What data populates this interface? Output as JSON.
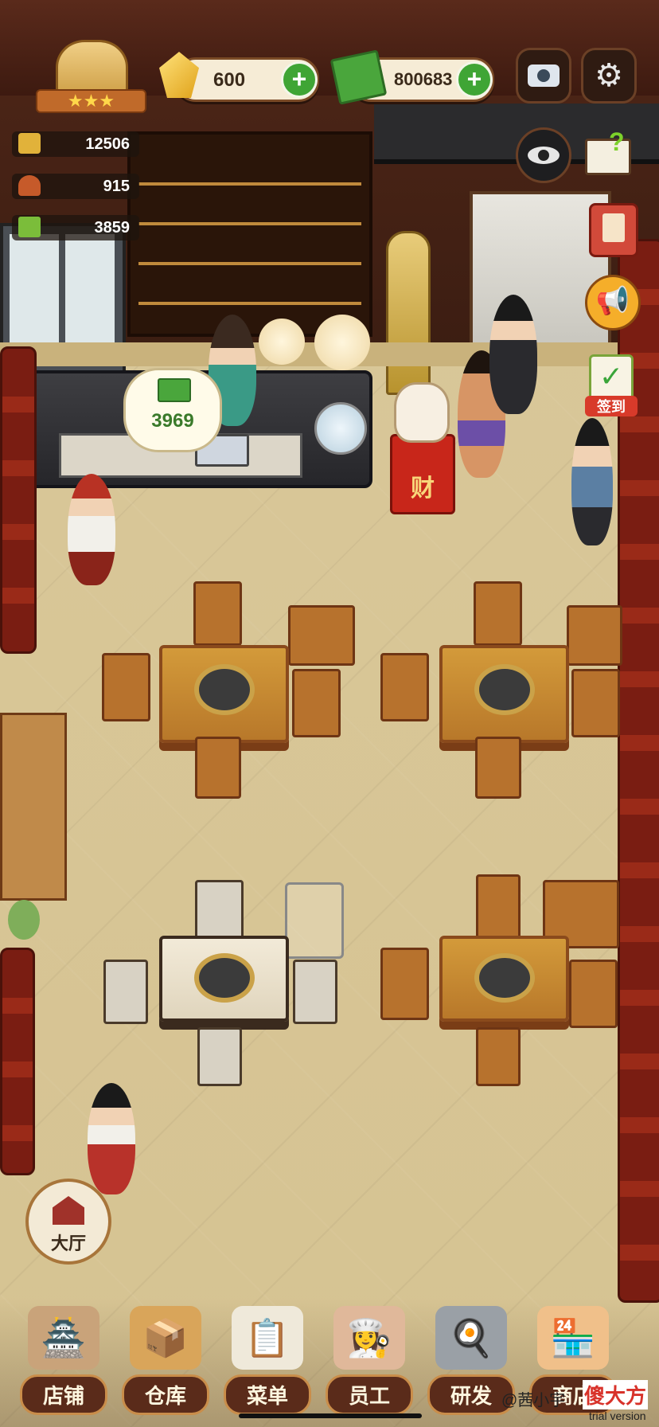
{
  "currency": {
    "gems": "600",
    "cash": "800683"
  },
  "stats": [
    {
      "icon": "hotpot-icon",
      "value": "12506"
    },
    {
      "icon": "dish-cover-icon",
      "value": "915"
    },
    {
      "icon": "menu-book-icon",
      "value": "3859"
    }
  ],
  "restaurant": {
    "tip_bubble_amount": "3969",
    "lucky_cat_plaque": "财"
  },
  "side_buttons": {
    "checkin_label": "签到"
  },
  "hall_button": {
    "label": "大厅"
  },
  "bottom_nav": [
    {
      "label": "店铺",
      "icon": "shop-building-icon"
    },
    {
      "label": "仓库",
      "icon": "warehouse-boxes-icon"
    },
    {
      "label": "菜单",
      "icon": "menu-clipboard-icon"
    },
    {
      "label": "员工",
      "icon": "staff-chef-icon"
    },
    {
      "label": "研发",
      "icon": "wok-icon"
    },
    {
      "label": "商店",
      "icon": "store-icon"
    }
  ],
  "watermark": {
    "author": "@茜小宇",
    "logo": "傻大方",
    "trial": "trial version"
  },
  "colors": {
    "accent_green": "#3fa535",
    "frame_brown": "#7a4a26",
    "floor": "#d6c392"
  }
}
